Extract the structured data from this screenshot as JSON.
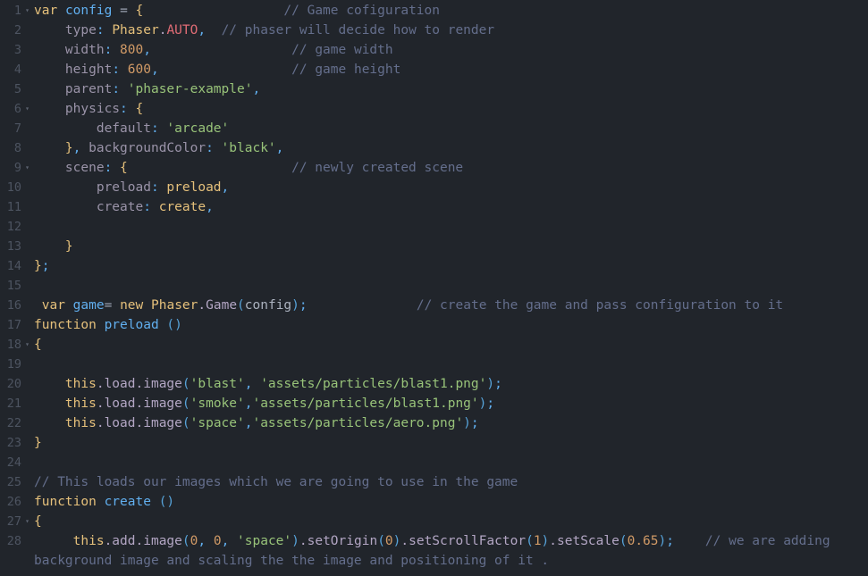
{
  "editor": {
    "name": "code-editor",
    "language": "JavaScript",
    "theme_background": "#21252b",
    "gutter_color": "#4d5461",
    "fold_glyph": "▾",
    "total_lines": 28,
    "colors": {
      "keyword": "#e5c07b",
      "variable": "#61afef",
      "string": "#98c379",
      "number": "#d19a66",
      "comment": "#646e8c",
      "property": "#b3a6c4",
      "key": "#9a93a8",
      "constant": "#e06c75",
      "punctuation": "#61afef",
      "text": "#abb2bf"
    },
    "lines": [
      {
        "n": "1",
        "fold": true,
        "text": "var config = {                  // Game cofiguration"
      },
      {
        "n": "2",
        "fold": false,
        "text": "    type: Phaser.AUTO,  // phaser will decide how to render"
      },
      {
        "n": "3",
        "fold": false,
        "text": "    width: 800,                  // game width"
      },
      {
        "n": "4",
        "fold": false,
        "text": "    height: 600,                 // game height"
      },
      {
        "n": "5",
        "fold": false,
        "text": "    parent: 'phaser-example',"
      },
      {
        "n": "6",
        "fold": true,
        "text": "    physics: {"
      },
      {
        "n": "7",
        "fold": false,
        "text": "        default: 'arcade'"
      },
      {
        "n": "8",
        "fold": false,
        "text": "    }, backgroundColor: 'black',"
      },
      {
        "n": "9",
        "fold": true,
        "text": "    scene: {                     // newly created scene"
      },
      {
        "n": "10",
        "fold": false,
        "text": "        preload: preload,"
      },
      {
        "n": "11",
        "fold": false,
        "text": "        create: create,"
      },
      {
        "n": "12",
        "fold": false,
        "text": ""
      },
      {
        "n": "13",
        "fold": false,
        "text": "    }"
      },
      {
        "n": "14",
        "fold": false,
        "text": "};"
      },
      {
        "n": "15",
        "fold": false,
        "text": ""
      },
      {
        "n": "16",
        "fold": false,
        "text": " var game= new Phaser.Game(config);              // create the game and pass configuration to it"
      },
      {
        "n": "17",
        "fold": false,
        "text": "function preload ()"
      },
      {
        "n": "18",
        "fold": true,
        "text": "{"
      },
      {
        "n": "19",
        "fold": false,
        "text": ""
      },
      {
        "n": "20",
        "fold": false,
        "text": "    this.load.image('blast', 'assets/particles/blast1.png');"
      },
      {
        "n": "21",
        "fold": false,
        "text": "    this.load.image('smoke','assets/particles/blast1.png');"
      },
      {
        "n": "22",
        "fold": false,
        "text": "    this.load.image('space','assets/particles/aero.png');"
      },
      {
        "n": "23",
        "fold": false,
        "text": "}"
      },
      {
        "n": "24",
        "fold": false,
        "text": ""
      },
      {
        "n": "25",
        "fold": false,
        "text": "// This loads our images which we are going to use in the game"
      },
      {
        "n": "26",
        "fold": false,
        "text": "function create ()"
      },
      {
        "n": "27",
        "fold": true,
        "text": "{"
      },
      {
        "n": "28",
        "fold": false,
        "text": "     this.add.image(0, 0, 'space').setOrigin(0).setScrollFactor(1).setScale(0.65);    // we are adding background image and scaling the the image and positioning of it ."
      }
    ],
    "tokens": [
      [
        [
          "t-kw",
          "var"
        ],
        [
          "t-plain",
          " "
        ],
        [
          "t-var",
          "config"
        ],
        [
          "t-plain",
          " "
        ],
        [
          "t-op",
          "="
        ],
        [
          "t-plain",
          " "
        ],
        [
          "t-punc",
          "{"
        ],
        [
          "t-plain",
          "                  "
        ],
        [
          "t-cmt",
          "// Game cofiguration"
        ]
      ],
      [
        [
          "t-plain",
          "    "
        ],
        [
          "t-key",
          "type"
        ],
        [
          "t-colon",
          ":"
        ],
        [
          "t-plain",
          " "
        ],
        [
          "t-class",
          "Phaser"
        ],
        [
          "t-prop",
          "."
        ],
        [
          "t-const",
          "AUTO"
        ],
        [
          "t-comma",
          ","
        ],
        [
          "t-plain",
          "  "
        ],
        [
          "t-cmt",
          "// phaser will decide how to render"
        ]
      ],
      [
        [
          "t-plain",
          "    "
        ],
        [
          "t-key",
          "width"
        ],
        [
          "t-colon",
          ":"
        ],
        [
          "t-plain",
          " "
        ],
        [
          "t-num",
          "800"
        ],
        [
          "t-comma",
          ","
        ],
        [
          "t-plain",
          "                  "
        ],
        [
          "t-cmt",
          "// game width"
        ]
      ],
      [
        [
          "t-plain",
          "    "
        ],
        [
          "t-key",
          "height"
        ],
        [
          "t-colon",
          ":"
        ],
        [
          "t-plain",
          " "
        ],
        [
          "t-num",
          "600"
        ],
        [
          "t-comma",
          ","
        ],
        [
          "t-plain",
          "                 "
        ],
        [
          "t-cmt",
          "// game height"
        ]
      ],
      [
        [
          "t-plain",
          "    "
        ],
        [
          "t-key",
          "parent"
        ],
        [
          "t-colon",
          ":"
        ],
        [
          "t-plain",
          " "
        ],
        [
          "t-str",
          "'phaser-example'"
        ],
        [
          "t-comma",
          ","
        ]
      ],
      [
        [
          "t-plain",
          "    "
        ],
        [
          "t-key",
          "physics"
        ],
        [
          "t-colon",
          ":"
        ],
        [
          "t-plain",
          " "
        ],
        [
          "t-punc",
          "{"
        ]
      ],
      [
        [
          "t-plain",
          "        "
        ],
        [
          "t-key",
          "default"
        ],
        [
          "t-colon",
          ":"
        ],
        [
          "t-plain",
          " "
        ],
        [
          "t-str",
          "'arcade'"
        ]
      ],
      [
        [
          "t-plain",
          "    "
        ],
        [
          "t-punc",
          "}"
        ],
        [
          "t-comma",
          ","
        ],
        [
          "t-plain",
          " "
        ],
        [
          "t-key",
          "backgroundColor"
        ],
        [
          "t-colon",
          ":"
        ],
        [
          "t-plain",
          " "
        ],
        [
          "t-str",
          "'black'"
        ],
        [
          "t-comma",
          ","
        ]
      ],
      [
        [
          "t-plain",
          "    "
        ],
        [
          "t-key",
          "scene"
        ],
        [
          "t-colon",
          ":"
        ],
        [
          "t-plain",
          " "
        ],
        [
          "t-punc",
          "{"
        ],
        [
          "t-plain",
          "                     "
        ],
        [
          "t-cmt",
          "// newly created scene"
        ]
      ],
      [
        [
          "t-plain",
          "        "
        ],
        [
          "t-key",
          "preload"
        ],
        [
          "t-colon",
          ":"
        ],
        [
          "t-plain",
          " "
        ],
        [
          "t-kw",
          "preload"
        ],
        [
          "t-comma",
          ","
        ]
      ],
      [
        [
          "t-plain",
          "        "
        ],
        [
          "t-key",
          "create"
        ],
        [
          "t-colon",
          ":"
        ],
        [
          "t-plain",
          " "
        ],
        [
          "t-kw",
          "create"
        ],
        [
          "t-comma",
          ","
        ]
      ],
      [],
      [
        [
          "t-plain",
          "    "
        ],
        [
          "t-punc",
          "}"
        ]
      ],
      [
        [
          "t-punc",
          "}"
        ],
        [
          "t-comma",
          ";"
        ]
      ],
      [],
      [
        [
          "t-plain",
          " "
        ],
        [
          "t-kw",
          "var"
        ],
        [
          "t-plain",
          " "
        ],
        [
          "t-var",
          "game"
        ],
        [
          "t-op",
          "="
        ],
        [
          "t-plain",
          " "
        ],
        [
          "t-kw",
          "new"
        ],
        [
          "t-plain",
          " "
        ],
        [
          "t-class",
          "Phaser"
        ],
        [
          "t-prop",
          "."
        ],
        [
          "t-prop",
          "Game"
        ],
        [
          "t-paren",
          "("
        ],
        [
          "t-plain",
          "config"
        ],
        [
          "t-paren",
          ")"
        ],
        [
          "t-comma",
          ";"
        ],
        [
          "t-plain",
          "              "
        ],
        [
          "t-cmt",
          "// create the game and pass configuration to it"
        ]
      ],
      [
        [
          "t-kw",
          "function"
        ],
        [
          "t-plain",
          " "
        ],
        [
          "t-var",
          "preload"
        ],
        [
          "t-plain",
          " "
        ],
        [
          "t-paren",
          "()"
        ]
      ],
      [
        [
          "t-punc",
          "{"
        ]
      ],
      [],
      [
        [
          "t-plain",
          "    "
        ],
        [
          "t-class",
          "this"
        ],
        [
          "t-prop",
          ".load"
        ],
        [
          "t-prop",
          ".image"
        ],
        [
          "t-paren",
          "("
        ],
        [
          "t-str",
          "'blast'"
        ],
        [
          "t-comma",
          ","
        ],
        [
          "t-plain",
          " "
        ],
        [
          "t-str",
          "'assets/particles/blast1.png'"
        ],
        [
          "t-paren",
          ")"
        ],
        [
          "t-comma",
          ";"
        ]
      ],
      [
        [
          "t-plain",
          "    "
        ],
        [
          "t-class",
          "this"
        ],
        [
          "t-prop",
          ".load"
        ],
        [
          "t-prop",
          ".image"
        ],
        [
          "t-paren",
          "("
        ],
        [
          "t-str",
          "'smoke'"
        ],
        [
          "t-comma",
          ","
        ],
        [
          "t-str",
          "'assets/particles/blast1.png'"
        ],
        [
          "t-paren",
          ")"
        ],
        [
          "t-comma",
          ";"
        ]
      ],
      [
        [
          "t-plain",
          "    "
        ],
        [
          "t-class",
          "this"
        ],
        [
          "t-prop",
          ".load"
        ],
        [
          "t-prop",
          ".image"
        ],
        [
          "t-paren",
          "("
        ],
        [
          "t-str",
          "'space'"
        ],
        [
          "t-comma",
          ","
        ],
        [
          "t-str",
          "'assets/particles/aero.png'"
        ],
        [
          "t-paren",
          ")"
        ],
        [
          "t-comma",
          ";"
        ]
      ],
      [
        [
          "t-punc",
          "}"
        ]
      ],
      [],
      [
        [
          "t-cmt",
          "// This loads our images which we are going to use in the game"
        ]
      ],
      [
        [
          "t-kw",
          "function"
        ],
        [
          "t-plain",
          " "
        ],
        [
          "t-var",
          "create"
        ],
        [
          "t-plain",
          " "
        ],
        [
          "t-paren",
          "()"
        ]
      ],
      [
        [
          "t-punc",
          "{"
        ]
      ],
      [
        [
          "t-plain",
          "     "
        ],
        [
          "t-class",
          "this"
        ],
        [
          "t-prop",
          ".add"
        ],
        [
          "t-prop",
          ".image"
        ],
        [
          "t-paren",
          "("
        ],
        [
          "t-num",
          "0"
        ],
        [
          "t-comma",
          ","
        ],
        [
          "t-plain",
          " "
        ],
        [
          "t-num",
          "0"
        ],
        [
          "t-comma",
          ","
        ],
        [
          "t-plain",
          " "
        ],
        [
          "t-str",
          "'space'"
        ],
        [
          "t-paren",
          ")"
        ],
        [
          "t-prop",
          ".setOrigin"
        ],
        [
          "t-paren",
          "("
        ],
        [
          "t-num",
          "0"
        ],
        [
          "t-paren",
          ")"
        ],
        [
          "t-prop",
          ".setScrollFactor"
        ],
        [
          "t-paren",
          "("
        ],
        [
          "t-num",
          "1"
        ],
        [
          "t-paren",
          ")"
        ],
        [
          "t-prop",
          ".setScale"
        ],
        [
          "t-paren",
          "("
        ],
        [
          "t-num",
          "0.65"
        ],
        [
          "t-paren",
          ")"
        ],
        [
          "t-comma",
          ";"
        ],
        [
          "t-plain",
          "    "
        ],
        [
          "t-cmt",
          "// we are adding background image and scaling the the image and positioning of it ."
        ]
      ]
    ]
  }
}
